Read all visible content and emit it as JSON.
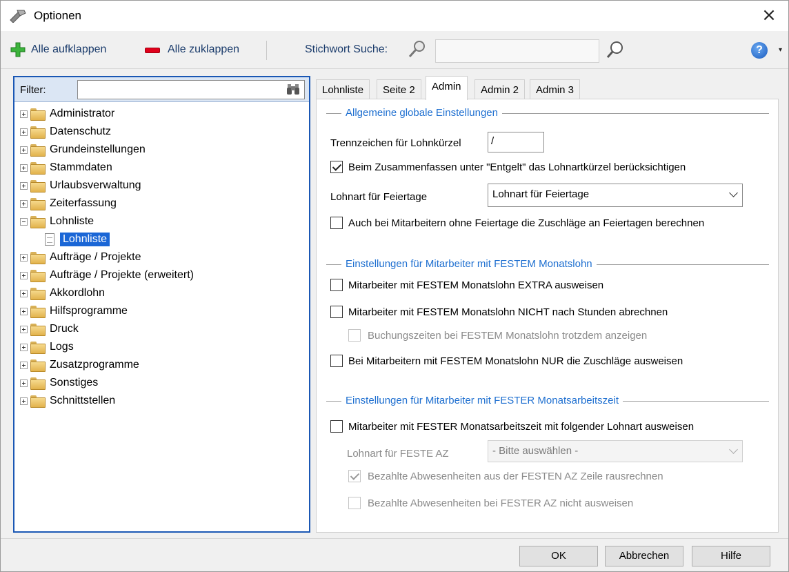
{
  "window": {
    "title": "Optionen",
    "close_glyph": "×"
  },
  "toolbar": {
    "expand_all_label": "Alle aufklappen",
    "collapse_all_label": "Alle zuklappen",
    "search_label": "Stichwort Suche:",
    "search_value": "",
    "help_glyph": "?",
    "help_arrow_glyph": "▾",
    "icons": [
      "plus-icon",
      "minus-icon",
      "key-icon",
      "search-icon",
      "help-icon"
    ]
  },
  "sidebar": {
    "filter_label": "Filter:",
    "filter_value": "",
    "items": [
      {
        "label": "Administrator"
      },
      {
        "label": "Datenschutz"
      },
      {
        "label": "Grundeinstellungen"
      },
      {
        "label": "Stammdaten"
      },
      {
        "label": "Urlaubsverwaltung"
      },
      {
        "label": "Zeiterfassung"
      },
      {
        "label": "Lohnliste"
      },
      {
        "label": "Lohnliste"
      },
      {
        "label": "Aufträge / Projekte"
      },
      {
        "label": "Aufträge / Projekte (erweitert)"
      },
      {
        "label": "Akkordlohn"
      },
      {
        "label": "Hilfsprogramme"
      },
      {
        "label": "Druck"
      },
      {
        "label": "Logs"
      },
      {
        "label": "Zusatzprogramme"
      },
      {
        "label": "Sonstiges"
      },
      {
        "label": "Schnittstellen"
      }
    ]
  },
  "tabs": [
    {
      "label": "Lohnliste"
    },
    {
      "label": "Seite 2"
    },
    {
      "label": "Admin"
    },
    {
      "label": "Admin 2"
    },
    {
      "label": "Admin 3"
    }
  ],
  "active_tab": "Admin",
  "general": {
    "title": "Allgemeine globale Einstellungen",
    "separator_label": "Trennzeichen für Lohnkürzel",
    "separator_value": "/",
    "combine_label": "Beim Zusammenfassen unter \"Entgelt\" das Lohnartkürzel berücksichtigen",
    "combine_checked": true,
    "holiday_wage_label": "Lohnart für Feiertage",
    "holiday_wage_value": "Lohnart für Feiertage",
    "holiday_surcharge_label": "Auch bei Mitarbeitern ohne Feiertage die Zuschläge an Feiertagen berechnen",
    "holiday_surcharge_checked": false
  },
  "fixed_salary": {
    "title": "Einstellungen für Mitarbeiter mit FESTEM Monatslohn",
    "extra_label": "Mitarbeiter mit FESTEM Monatslohn EXTRA ausweisen",
    "not_hours_label": "Mitarbeiter mit FESTEM Monatslohn NICHT nach Stunden abrechnen",
    "booking_label": "Buchungszeiten bei FESTEM Monatslohn trotzdem anzeigen",
    "only_surcharge_label": "Bei Mitarbeitern mit FESTEM Monatslohn NUR die Zuschläge ausweisen"
  },
  "fixed_hours": {
    "title": "Einstellungen für Mitarbeiter mit FESTER Monatsarbeitszeit",
    "show_label": "Mitarbeiter mit FESTER Monatsarbeitszeit mit folgender Lohnart ausweisen",
    "wage_label": "Lohnart für FESTE AZ",
    "wage_value": "- Bitte auswählen -",
    "paid_absence_calc_label": "Bezahlte Abwesenheiten aus der FESTEN AZ Zeile rausrechnen",
    "paid_absence_calc_checked": true,
    "paid_absence_hide_label": "Bezahlte Abwesenheiten bei FESTER AZ nicht ausweisen"
  },
  "buttons": {
    "ok": "OK",
    "cancel": "Abbrechen",
    "help": "Hilfe"
  }
}
